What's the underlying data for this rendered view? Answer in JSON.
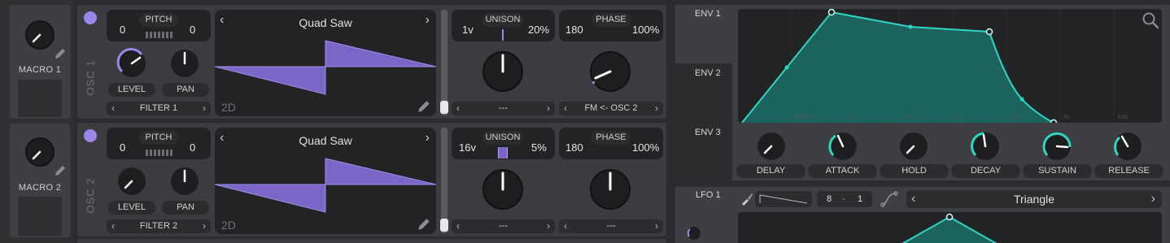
{
  "macros": [
    {
      "label": "MACRO 1"
    },
    {
      "label": "MACRO 2"
    }
  ],
  "oscillators": [
    {
      "side_label": "OSC 1",
      "pitch_label": "PITCH",
      "pitch_left": "0",
      "pitch_right": "0",
      "level_label": "LEVEL",
      "pan_label": "PAN",
      "filter_route": "FILTER 1",
      "wave_name": "Quad Saw",
      "wave_mode": "2D",
      "unison_label": "UNISON",
      "unison_voices": "1v",
      "unison_detune": "20%",
      "phase_label": "PHASE",
      "phase_value": "180",
      "phase_random": "100%",
      "unison_route": "---",
      "phase_route": "FM <- OSC 2"
    },
    {
      "side_label": "OSC 2",
      "pitch_label": "PITCH",
      "pitch_left": "0",
      "pitch_right": "0",
      "level_label": "LEVEL",
      "pan_label": "PAN",
      "filter_route": "FILTER 2",
      "wave_name": "Quad Saw",
      "wave_mode": "2D",
      "unison_label": "UNISON",
      "unison_voices": "16v",
      "unison_detune": "5%",
      "phase_label": "PHASE",
      "phase_value": "180",
      "phase_random": "100%",
      "unison_route": "---",
      "phase_route": "---"
    }
  ],
  "envelope_tabs": [
    "ENV 1",
    "ENV 2",
    "ENV 3"
  ],
  "envelope_time_ticks": [
    "500ms",
    "1s",
    "1.5s",
    "2s",
    "2.5s",
    "3s",
    "3.5s"
  ],
  "envelope_knobs": [
    "DELAY",
    "ATTACK",
    "HOLD",
    "DECAY",
    "SUSTAIN",
    "RELEASE"
  ],
  "lfo": {
    "tab": "LFO 1",
    "rate_num": "8",
    "rate_sep": "-",
    "rate_den": "1",
    "shape": "Triangle"
  },
  "colors": {
    "accent_purple": "#9d86e9",
    "accent_teal": "#2fd6c4",
    "panel": "#3a3c3f",
    "dark": "#222325"
  },
  "icons": [
    "pencil-icon",
    "magnifier-icon",
    "paintbrush-icon",
    "curve-icon",
    "chevron-left-icon",
    "chevron-right-icon"
  ]
}
